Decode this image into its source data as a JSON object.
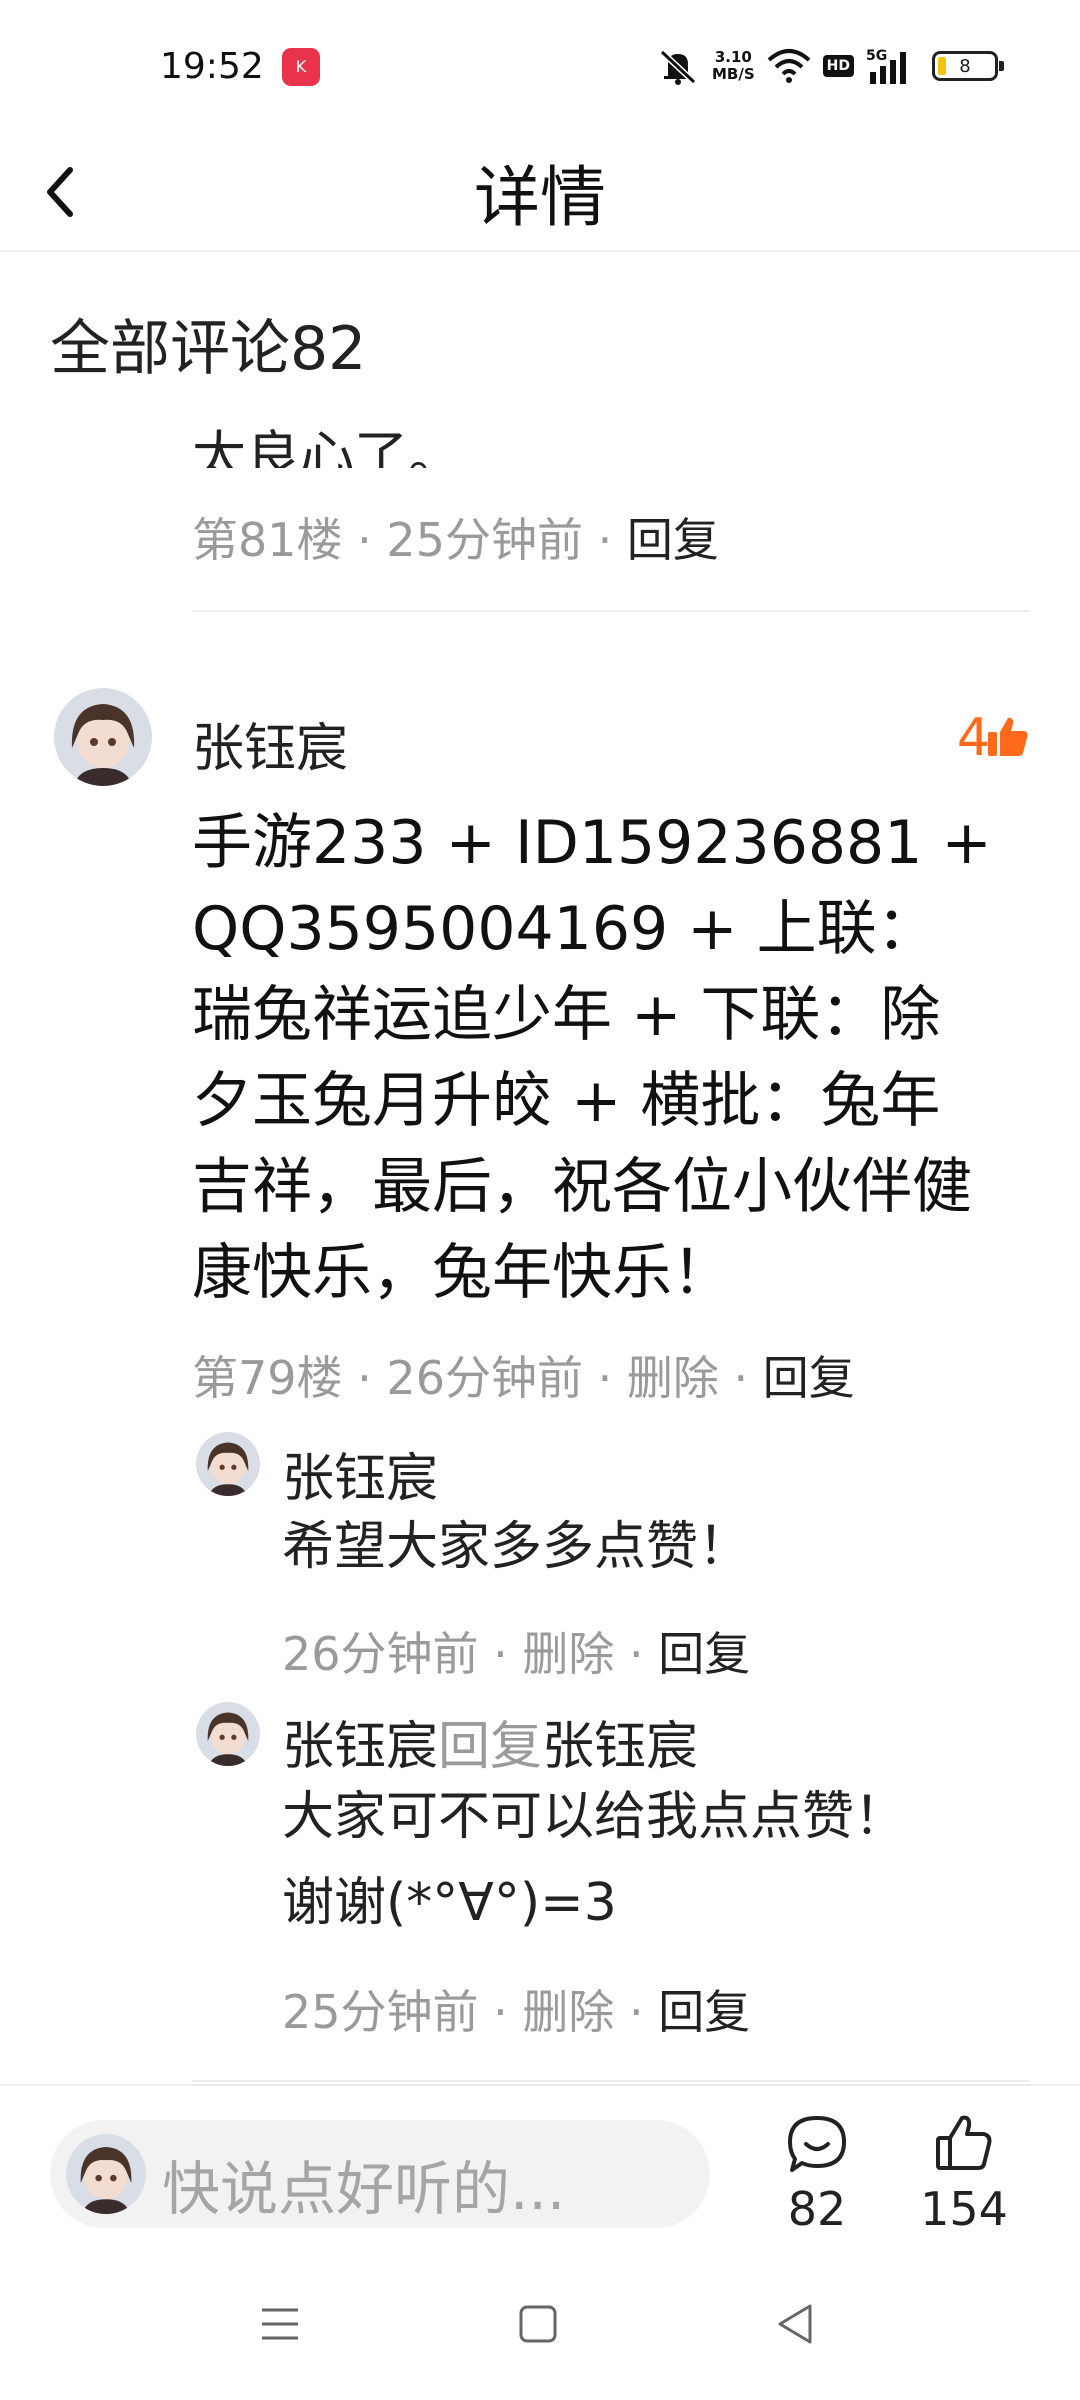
{
  "status_bar": {
    "time": "19:52",
    "app_icon": "quanmin-kge-app-icon",
    "net_speed_value": "3.10",
    "net_speed_unit": "MB/S",
    "hd": "HD",
    "network": "5G",
    "battery": "8"
  },
  "header": {
    "title": "详情",
    "back_icon": "chevron-left-icon"
  },
  "comments_section": {
    "title": "全部评论82"
  },
  "prev_comment": {
    "clipped_text": "太良心了。",
    "floor": "第81楼",
    "time": "25分钟前",
    "reply": "回复"
  },
  "comment": {
    "author": "张钰宸",
    "likes": "4",
    "body": "手游233 + ID159236881 + QQ3595004169 + 上联：瑞兔祥运追少年 + 下联：除夕玉兔月升皎 + 横批：兔年吉祥，最后，祝各位小伙伴健康快乐，兔年快乐！",
    "floor": "第79楼",
    "time": "26分钟前",
    "delete": "删除",
    "reply": "回复"
  },
  "replies": [
    {
      "author": "张钰宸",
      "text": "希望大家多多点赞！",
      "time": "26分钟前",
      "delete": "删除",
      "reply": "回复"
    },
    {
      "author": "张钰宸",
      "reply_word": "回复",
      "target": "张钰宸",
      "text_line1": "大家可不可以给我点点赞！",
      "text_line2": "谢谢(*°∀°)=3",
      "time": "25分钟前",
      "delete": "删除",
      "reply": "回复"
    }
  ],
  "bottom_bar": {
    "placeholder": "快说点好听的...",
    "comment_count": "82",
    "like_count": "154"
  },
  "colors": {
    "accent": "#ff6a1a",
    "meta": "#9a9a9a",
    "text": "#222222"
  }
}
